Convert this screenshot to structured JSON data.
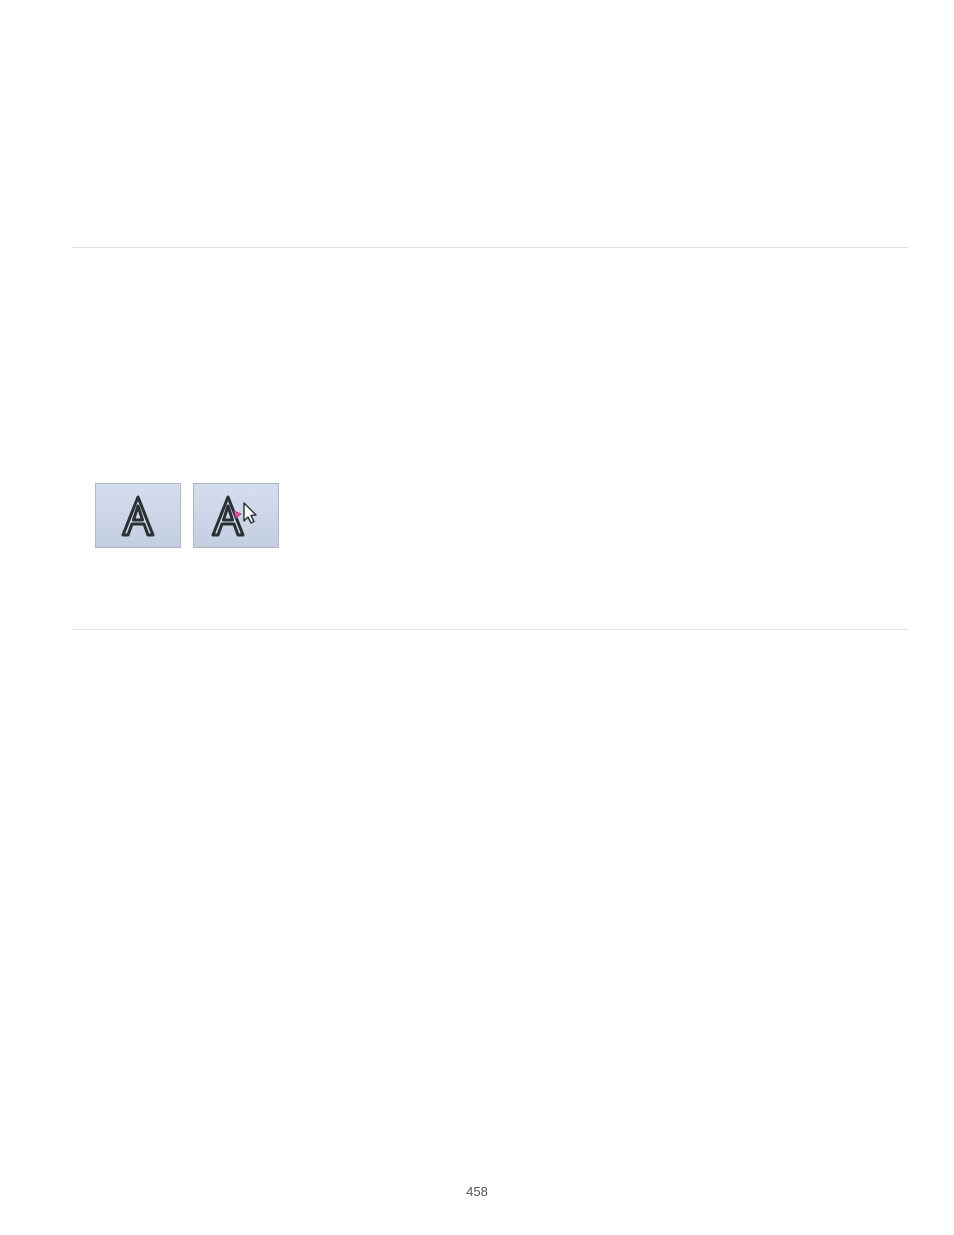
{
  "page": {
    "number": "458"
  },
  "buttons": [
    {
      "name": "text-letter-button",
      "interactable": true
    },
    {
      "name": "text-letter-cursor-button",
      "interactable": true
    }
  ]
}
